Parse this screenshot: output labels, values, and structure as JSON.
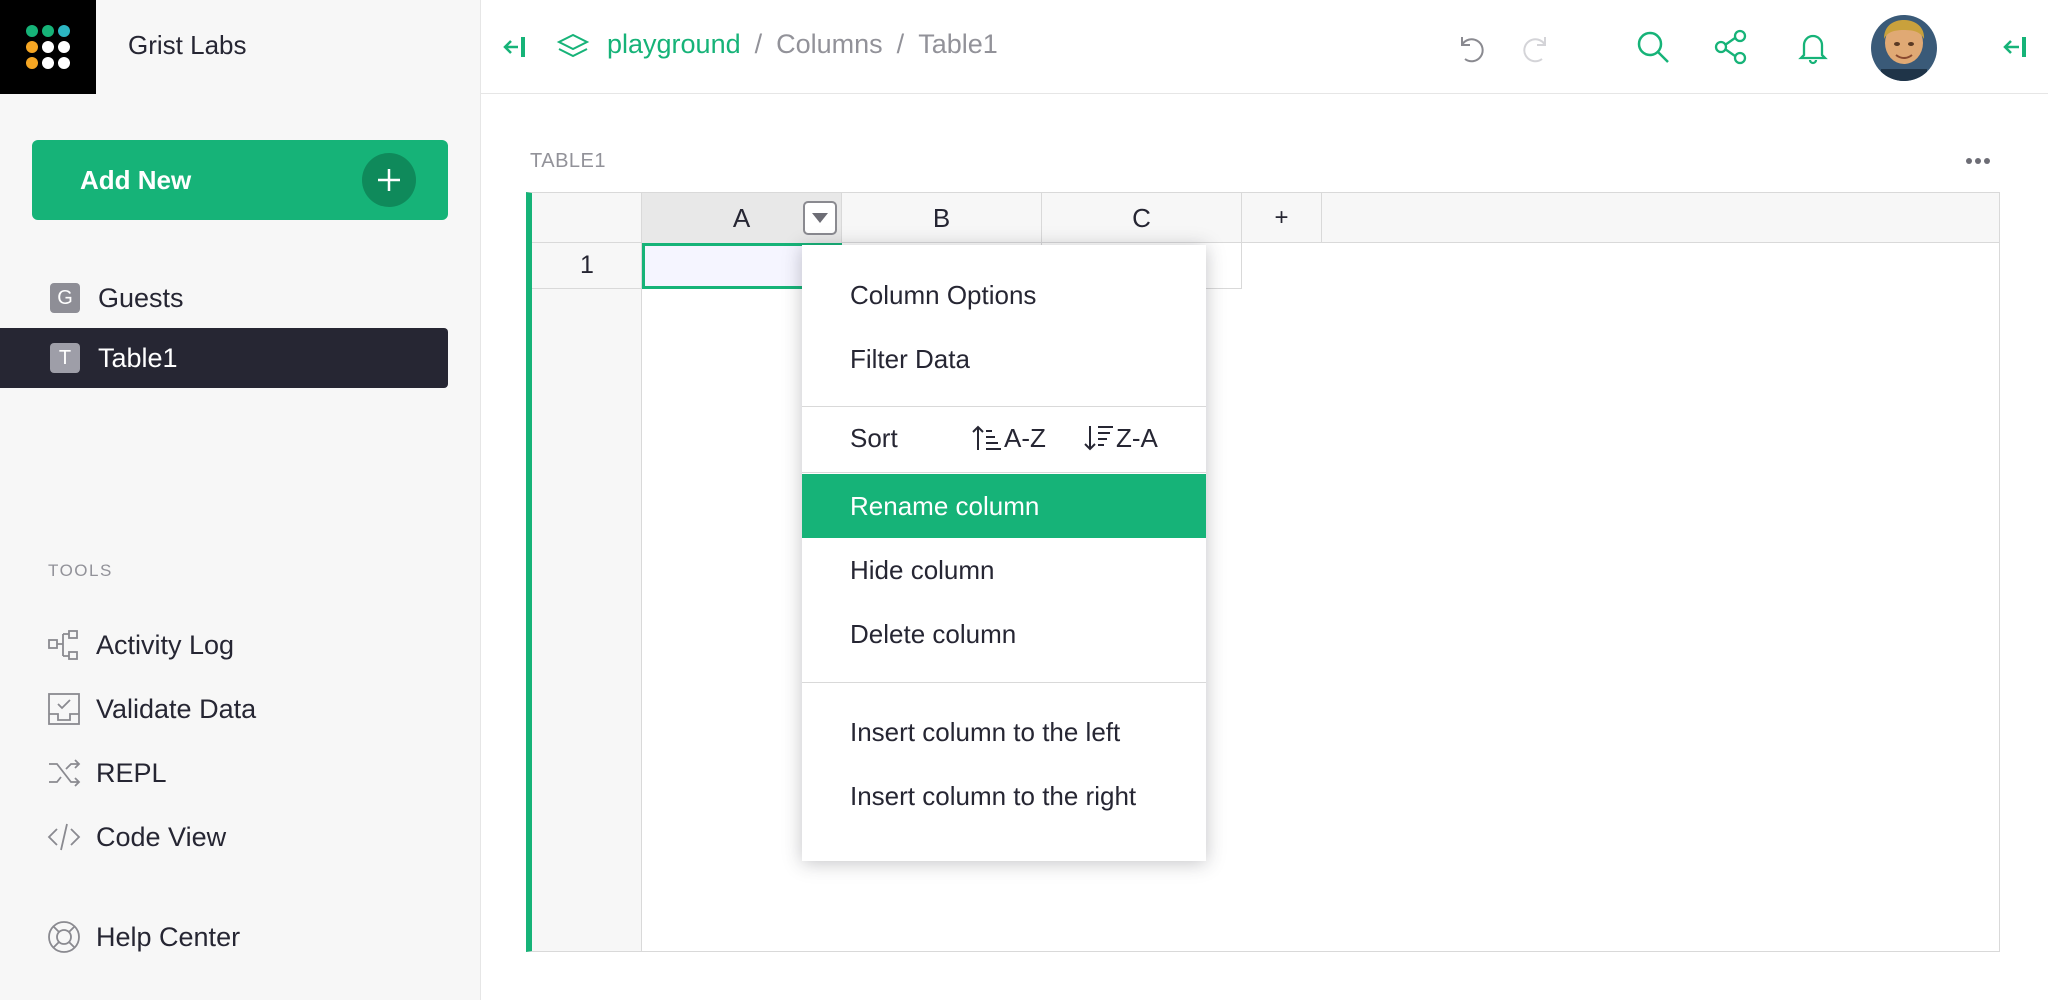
{
  "sidebar": {
    "org_name": "Grist Labs",
    "add_new_label": "Add New",
    "pages": [
      {
        "initial": "G",
        "label": "Guests",
        "active": false
      },
      {
        "initial": "T",
        "label": "Table1",
        "active": true
      }
    ],
    "tools_title": "TOOLS",
    "tools": [
      {
        "icon": "activity-log-icon",
        "label": "Activity Log"
      },
      {
        "icon": "validate-data-icon",
        "label": "Validate Data"
      },
      {
        "icon": "repl-icon",
        "label": "REPL"
      },
      {
        "icon": "code-view-icon",
        "label": "Code View"
      },
      {
        "icon": "help-center-icon",
        "label": "Help Center"
      }
    ]
  },
  "topbar": {
    "workspace": "playground",
    "separator": "/",
    "doc": "Columns",
    "page": "Table1"
  },
  "section": {
    "title": "TABLE1"
  },
  "grid": {
    "columns": [
      "A",
      "B",
      "C"
    ],
    "add_column": "+",
    "rows": [
      "1"
    ]
  },
  "column_menu": {
    "items_top": [
      "Column Options",
      "Filter Data"
    ],
    "sort_label": "Sort",
    "sort_asc": "A-Z",
    "sort_desc": "Z-A",
    "items_mid": [
      "Rename column",
      "Hide column",
      "Delete column"
    ],
    "highlighted": "Rename column",
    "items_bottom": [
      "Insert column to the left",
      "Insert column to the right"
    ]
  },
  "colors": {
    "accent": "#16b378",
    "dark": "#262633",
    "muted": "#929299"
  }
}
